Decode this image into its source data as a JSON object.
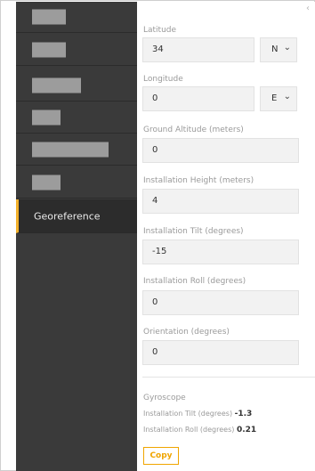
{
  "sidebar": {
    "items": [
      {
        "label": ""
      },
      {
        "label": ""
      },
      {
        "label": ""
      },
      {
        "label": ""
      },
      {
        "label": ""
      },
      {
        "label": ""
      },
      {
        "label": "Georeference",
        "active": true
      }
    ]
  },
  "panel": {
    "collapse_icon": "chevron-left",
    "latitude": {
      "label": "Latitude",
      "value": "34",
      "hemisphere": "N"
    },
    "longitude": {
      "label": "Longitude",
      "value": "0",
      "hemisphere": "E"
    },
    "ground_altitude": {
      "label": "Ground Altitude (meters)",
      "value": "0"
    },
    "installation_height": {
      "label": "Installation Height (meters)",
      "value": "4"
    },
    "installation_tilt": {
      "label": "Installation Tilt (degrees)",
      "value": "-15"
    },
    "installation_roll": {
      "label": "Installation Roll (degrees)",
      "value": "0"
    },
    "orientation": {
      "label": "Orientation (degrees)",
      "value": "0"
    }
  },
  "gyroscope": {
    "title": "Gyroscope",
    "tilt_label": "Installation Tilt (degrees)",
    "tilt_value": "-1.3",
    "roll_label": "Installation Roll (degrees)",
    "roll_value": "0.21",
    "copy_label": "Copy"
  },
  "colors": {
    "accent": "#f0a500",
    "sidebar_bg": "#3a3a3a",
    "active_bg": "#2c2c2c"
  }
}
